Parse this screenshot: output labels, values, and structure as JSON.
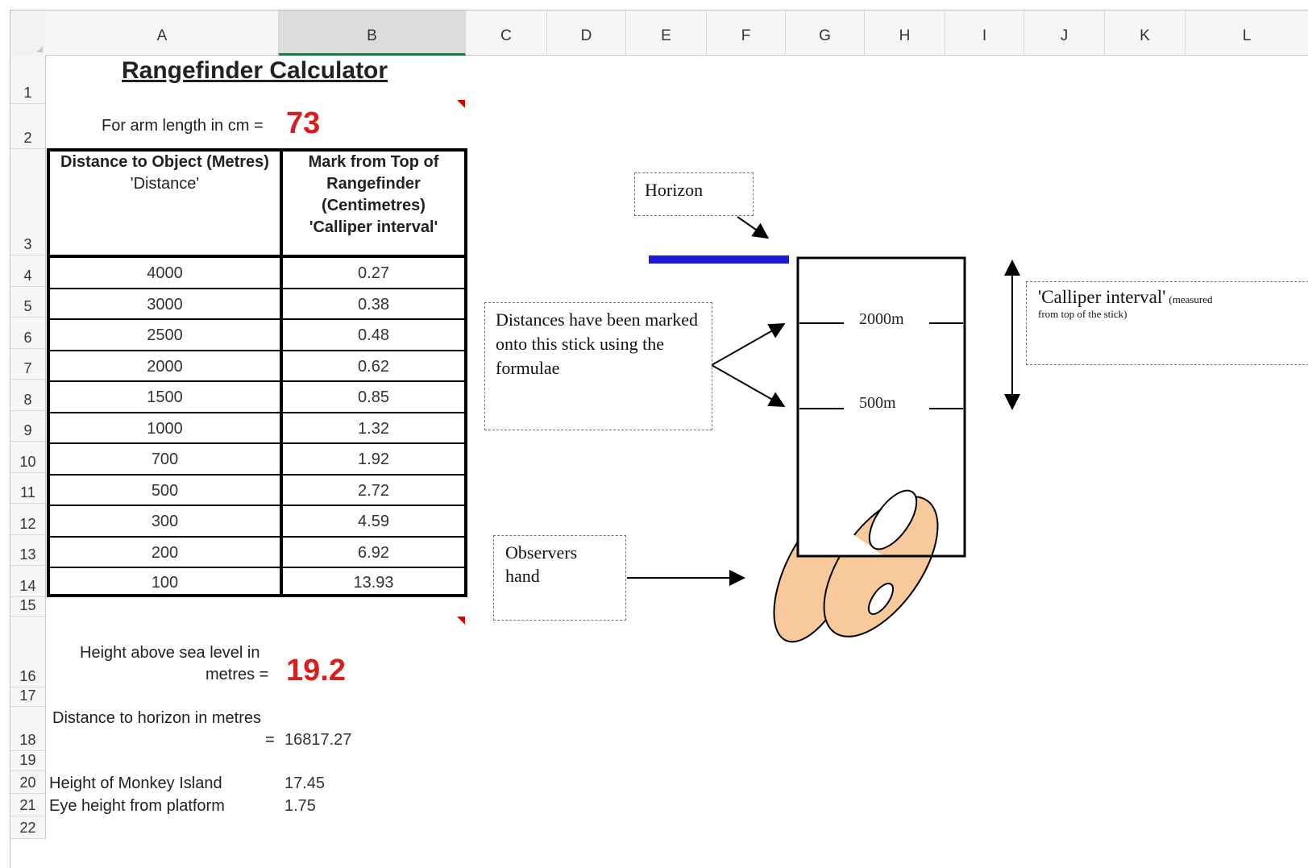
{
  "columns": [
    "A",
    "B",
    "C",
    "D",
    "E",
    "F",
    "G",
    "H",
    "I",
    "J",
    "K",
    "L"
  ],
  "rows": [
    "1",
    "2",
    "3",
    "4",
    "5",
    "6",
    "7",
    "8",
    "9",
    "10",
    "11",
    "12",
    "13",
    "14",
    "15",
    "16",
    "17",
    "18",
    "19",
    "20",
    "21",
    "22"
  ],
  "sheet": {
    "title": "Rangefinder Calculator",
    "arm_label": "For arm length in cm =",
    "arm_value": "73",
    "table": {
      "header_distance": [
        "Distance to Object  (Metres)",
        "'Distance'"
      ],
      "header_mark": [
        "Mark from Top of",
        "Rangefinder",
        "(Centimetres)",
        "'Calliper interval'"
      ],
      "rows": [
        {
          "distance": "4000",
          "mark": "0.27"
        },
        {
          "distance": "3000",
          "mark": "0.38"
        },
        {
          "distance": "2500",
          "mark": "0.48"
        },
        {
          "distance": "2000",
          "mark": "0.62"
        },
        {
          "distance": "1500",
          "mark": "0.85"
        },
        {
          "distance": "1000",
          "mark": "1.32"
        },
        {
          "distance": "700",
          "mark": "1.92"
        },
        {
          "distance": "500",
          "mark": "2.72"
        },
        {
          "distance": "300",
          "mark": "4.59"
        },
        {
          "distance": "200",
          "mark": "6.92"
        },
        {
          "distance": "100",
          "mark": "13.93"
        }
      ]
    },
    "height_label_1": "Height above sea level in",
    "height_label_2": "metres =",
    "height_value": "19.2",
    "horizon_label_1": "Distance to horizon in metres",
    "horizon_label_2": "=",
    "horizon_value": "16817.27",
    "monkey_label": "Height of Monkey Island",
    "monkey_value": "17.45",
    "eye_label": "Eye height from platform",
    "eye_value": "1.75"
  },
  "diagram": {
    "horizon_note": "Horizon",
    "distances_note": "Distances have been marked onto this stick using the formulae",
    "observer_note_1": "Observers",
    "observer_note_2": "hand",
    "calliper_note_main": "'Calliper interval'",
    "calliper_note_small_1": "(measured",
    "calliper_note_small_2": "from top of the stick)",
    "mark_2000": "2000m",
    "mark_500": "500m"
  },
  "colors": {
    "accent_green": "#217346",
    "value_red": "#d62020",
    "horizon_blue": "#1a1ad6",
    "hand_fill": "#f8c99a"
  }
}
